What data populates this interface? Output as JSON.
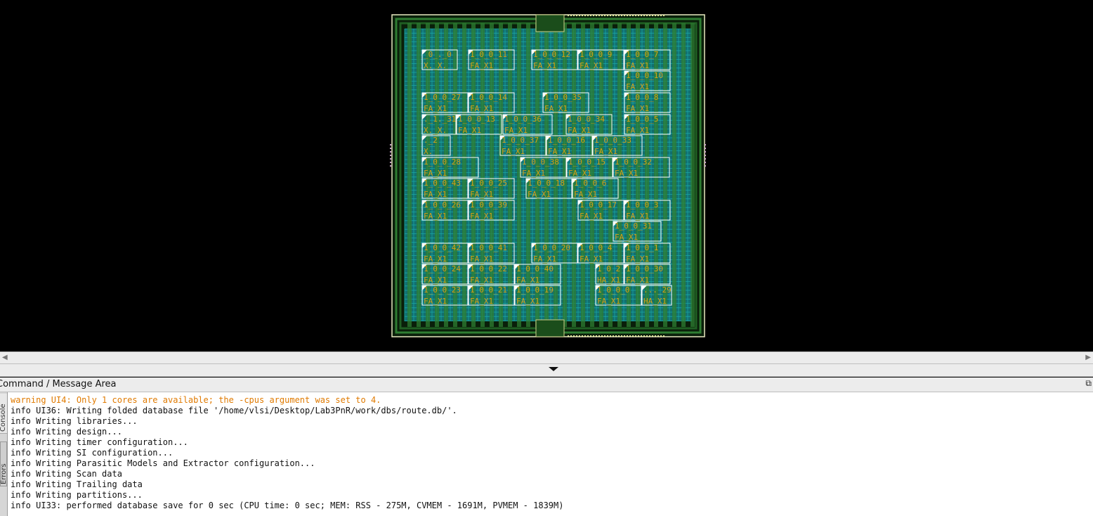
{
  "layout_view": {
    "background": "#000000",
    "die_border_color": "#e8e8c0",
    "core_ring_color": "#1aa6a6",
    "power_stripe_color": "#2e7d32",
    "cell_label_color": "#d4a017",
    "cell_outline_color": "#ffffff",
    "cells": [
      {
        "inst": "_0_._0",
        "type": "X._X."
      },
      {
        "inst": "1_0_0_11",
        "type": "FA_X1"
      },
      {
        "inst": "1_0_0_12",
        "type": "FA_X1"
      },
      {
        "inst": "1_0_0_9",
        "type": "FA_X1"
      },
      {
        "inst": "1_0_0_7",
        "type": "FA_X1"
      },
      {
        "inst": "1_0_0_10",
        "type": "FA_X1"
      },
      {
        "inst": "1_0_0_27",
        "type": "FA_X1"
      },
      {
        "inst": "1_0_0_14",
        "type": "FA_X1"
      },
      {
        "inst": "1_0_0_35",
        "type": "FA_X1"
      },
      {
        "inst": "1_0_0_8",
        "type": "FA_X1"
      },
      {
        "inst": "._1._31",
        "type": "X._X."
      },
      {
        "inst": "1_0_0_13",
        "type": "FA_X1"
      },
      {
        "inst": "1_0_0_36",
        "type": "FA_X1"
      },
      {
        "inst": "1_0_0_34",
        "type": "FA_X1"
      },
      {
        "inst": "1_0_0_5",
        "type": "FA_X1"
      },
      {
        "inst": "._2",
        "type": "X."
      },
      {
        "inst": "1_0_0_37",
        "type": "FA_X1"
      },
      {
        "inst": "1_0_0_16",
        "type": "FA_X1"
      },
      {
        "inst": "1_0_0_33",
        "type": "FA_X1"
      },
      {
        "inst": "1_0_0_28",
        "type": "FA_X1"
      },
      {
        "inst": "1_0_0_38",
        "type": "FA_X1"
      },
      {
        "inst": "1_0_0_15",
        "type": "FA_X1"
      },
      {
        "inst": "1_0_0_32",
        "type": "FA_X1"
      },
      {
        "inst": "1_0_0_43",
        "type": "FA_X1"
      },
      {
        "inst": "1_0_0_25",
        "type": "FA_X1"
      },
      {
        "inst": "1_0_0_18",
        "type": "FA_X1"
      },
      {
        "inst": "1_0_0_6",
        "type": "FA_X1"
      },
      {
        "inst": "1_0_0_26",
        "type": "FA_X1"
      },
      {
        "inst": "1_0_0_39",
        "type": "FA_X1"
      },
      {
        "inst": "1_0_0_17",
        "type": "FA_X1"
      },
      {
        "inst": "1_0_0_3",
        "type": "FA_X1"
      },
      {
        "inst": "1_0_0_31",
        "type": "FA_X1"
      },
      {
        "inst": "1_0_0_42",
        "type": "FA_X1"
      },
      {
        "inst": "1_0_0_41",
        "type": "FA_X1"
      },
      {
        "inst": "1_0_0_20",
        "type": "FA_X1"
      },
      {
        "inst": "1_0_0_4",
        "type": "FA_X1"
      },
      {
        "inst": "1_0_0_1",
        "type": "FA_X1"
      },
      {
        "inst": "1_0_0_24",
        "type": "FA_X1"
      },
      {
        "inst": "1_0_0_22",
        "type": "FA_X1"
      },
      {
        "inst": "1_0_0_40",
        "type": "FA_X1"
      },
      {
        "inst": "1_0_2",
        "type": "HA_X1"
      },
      {
        "inst": "1_0_0_30",
        "type": "FA_X1"
      },
      {
        "inst": "1_0_0_23",
        "type": "FA_X1"
      },
      {
        "inst": "1_0_0_21",
        "type": "FA_X1"
      },
      {
        "inst": "1_0_0_19",
        "type": "FA_X1"
      },
      {
        "inst": "1_0_0_0",
        "type": "FA_X1"
      },
      {
        "inst": "..._29",
        "type": "HA_X1"
      }
    ]
  },
  "scrollbar": {
    "left_arrow": "◀",
    "right_arrow": "▶"
  },
  "panel": {
    "title": "Command / Message Area",
    "undock_icon": "⧉",
    "side_tabs": [
      "Console",
      "Errors"
    ]
  },
  "messages": [
    {
      "level": "warning",
      "text": "warning UI4: Only 1 cores are available; the -cpus argument was set to 4."
    },
    {
      "level": "info",
      "text": "info UI36: Writing folded database file '/home/vlsi/Desktop/Lab3PnR/work/dbs/route.db/'."
    },
    {
      "level": "info",
      "text": "info Writing libraries..."
    },
    {
      "level": "info",
      "text": "info Writing design..."
    },
    {
      "level": "info",
      "text": "info Writing timer configuration..."
    },
    {
      "level": "info",
      "text": "info Writing SI configuration..."
    },
    {
      "level": "info",
      "text": "info Writing Parasitic Models and Extractor configuration..."
    },
    {
      "level": "info",
      "text": "info Writing Scan data"
    },
    {
      "level": "info",
      "text": "info Writing Trailing data"
    },
    {
      "level": "info",
      "text": "info Writing partitions..."
    },
    {
      "level": "info",
      "text": "info UI33: performed database save for 0 sec (CPU time: 0 sec; MEM: RSS - 275M, CVMEM - 1691M, PVMEM - 1839M)"
    }
  ]
}
